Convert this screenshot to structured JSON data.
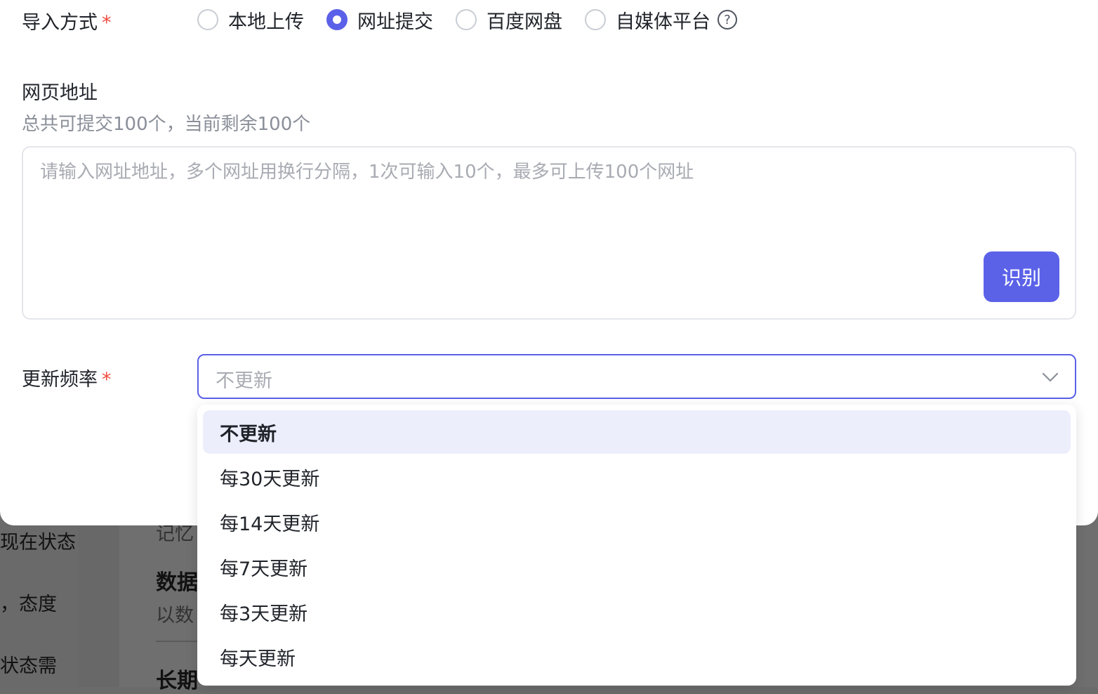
{
  "form": {
    "import_method": {
      "label": "导入方式",
      "required_mark": "*",
      "options": [
        {
          "label": "本地上传",
          "checked": false
        },
        {
          "label": "网址提交",
          "checked": true
        },
        {
          "label": "百度网盘",
          "checked": false
        },
        {
          "label": "自媒体平台",
          "checked": false
        }
      ],
      "help_icon": "question-circle-icon",
      "help_glyph": "?"
    },
    "web_address": {
      "label": "网页地址",
      "hint": "总共可提交100个，当前剩余100个",
      "placeholder": "请输入网址地址，多个网址用换行分隔，1次可输入10个，最多可上传100个网址",
      "recognize_button": "识别"
    },
    "update_frequency": {
      "label": "更新频率",
      "required_mark": "*",
      "selected_value": "不更新",
      "options": [
        "不更新",
        "每30天更新",
        "每14天更新",
        "每7天更新",
        "每3天更新",
        "每天更新"
      ],
      "selected_index": 0
    }
  },
  "background": {
    "left_texts": [
      "现在状态",
      "，态度",
      "状态需"
    ],
    "main_texts": [
      "记忆",
      "数据",
      "以数",
      "长期"
    ]
  },
  "colors": {
    "accent": "#5b60e8",
    "button": "#5b62e8",
    "required": "#f04a3c",
    "placeholder": "#a8abb2",
    "selected_bg": "#eceefb"
  }
}
